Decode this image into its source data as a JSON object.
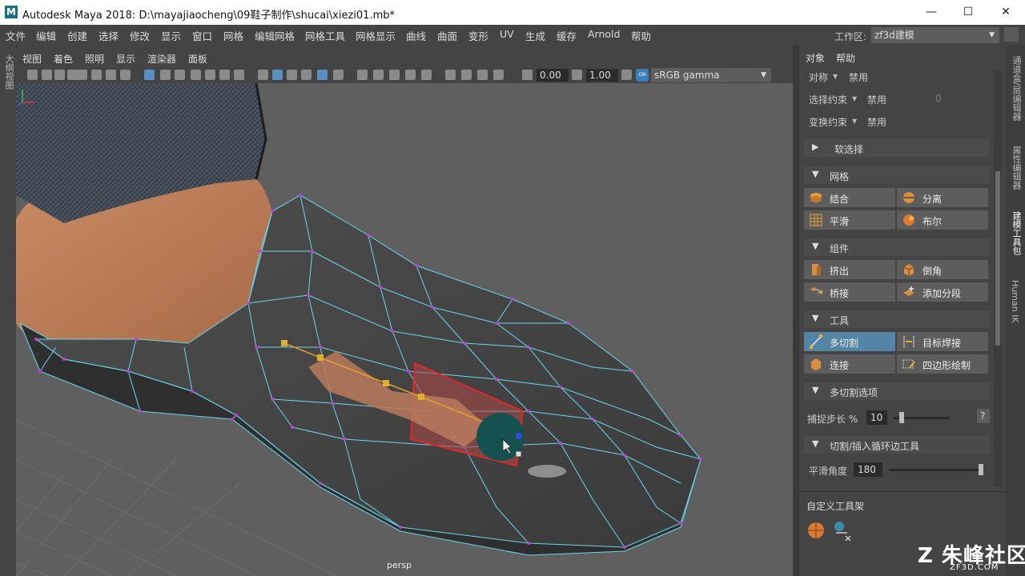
{
  "window": {
    "app_icon": "M",
    "title": "Autodesk Maya 2018: D:\\mayajiaocheng\\09鞋子制作\\shucai\\xiezi01.mb*",
    "controls": [
      "—",
      "☐",
      "✕"
    ]
  },
  "menubar": {
    "items": [
      "文件",
      "编辑",
      "创建",
      "选择",
      "修改",
      "显示",
      "窗口",
      "网格",
      "编辑网格",
      "网格工具",
      "网格显示",
      "曲线",
      "曲面",
      "变形",
      "UV",
      "生成",
      "缓存",
      "Arnold",
      "帮助"
    ],
    "workspace_label": "工作区:",
    "workspace_value": "zf3d建模"
  },
  "left_strip": {
    "label": "大纲视图"
  },
  "panel_menu": {
    "items": [
      "视图",
      "着色",
      "照明",
      "显示",
      "渲染器",
      "面板"
    ]
  },
  "view_toolbar": {
    "exposure": "0.00",
    "gamma": "1.00",
    "colorspace_toggle": "ON",
    "colorspace": "sRGB gamma"
  },
  "viewport": {
    "camera": "persp",
    "axis": [
      "x",
      "y",
      "z"
    ]
  },
  "right_panel": {
    "menu": [
      "对象",
      "帮助"
    ],
    "symmetry_label": "对称",
    "symmetry_value": "禁用",
    "select_constraint_label": "选择约束",
    "select_constraint_value": "禁用",
    "select_constraint_num": "0",
    "transform_constraint_label": "变换约束",
    "transform_constraint_value": "禁用",
    "soft_select": "软选择",
    "mesh_section": "网格",
    "mesh_tools": [
      "结合",
      "分离",
      "平滑",
      "布尔"
    ],
    "component_section": "组件",
    "component_tools": [
      "挤出",
      "倒角",
      "桥接",
      "添加分段"
    ],
    "tools_section": "工具",
    "tools": [
      "多切割",
      "目标焊接",
      "连接",
      "四边形绘制"
    ],
    "multicut_options": "多切割选项",
    "snap_step_label": "捕捉步长 %",
    "snap_step_value": "10",
    "snap_step_fraction": 0.11,
    "help_btn": "?",
    "loop_section": "切割/插入循环边工具",
    "smooth_angle_label": "平滑角度",
    "smooth_angle_value": "180",
    "smooth_angle_fraction": 1.0,
    "custom_shelf": "自定义工具架"
  },
  "right_tabs": [
    "通道盒/层编辑器",
    "属性编辑器",
    "建模工具包",
    "Human IK"
  ],
  "watermark": {
    "logo": "Z",
    "big": "朱峰社区",
    "small": "ZF3D.COM"
  }
}
